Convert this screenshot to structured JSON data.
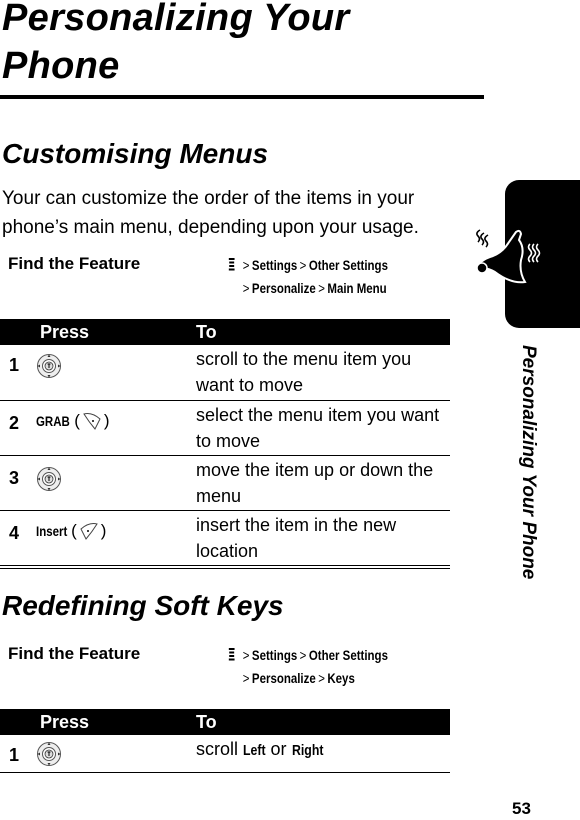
{
  "page": {
    "title": "Personalizing Your Phone",
    "side_tab_label": "Personalizing Your Phone",
    "page_number": "53",
    "side_icon": "bell-vibrate-icon"
  },
  "sections": [
    {
      "title": "Customising Menus",
      "intro": "Your can customize the order of the items in your phone’s main menu, depending upon your usage.",
      "find_feature": {
        "label": "Find the Feature",
        "icon": "menu-key-icon",
        "path_line1": [
          "Settings",
          "Other Settings"
        ],
        "path_line2": [
          "Personalize",
          "Main Menu"
        ],
        "separator": ">"
      },
      "table": {
        "headers": {
          "press": "Press",
          "to": "To"
        },
        "rows": [
          {
            "num": "1",
            "press_label": "",
            "press_icon": "nav-key-icon",
            "to": "scroll to the menu item you want to move"
          },
          {
            "num": "2",
            "press_label": "GRAB",
            "press_icon": "left-soft-key-icon",
            "to": "select the menu item you want to move"
          },
          {
            "num": "3",
            "press_label": "",
            "press_icon": "nav-key-icon",
            "to": "move the item up or down the menu"
          },
          {
            "num": "4",
            "press_label": "Insert",
            "press_icon": "right-soft-key-icon",
            "to": "insert the item in the new location"
          }
        ]
      }
    },
    {
      "title": "Redefining Soft Keys",
      "find_feature": {
        "label": "Find the Feature",
        "icon": "menu-key-icon",
        "path_line1": [
          "Settings",
          "Other Settings"
        ],
        "path_line2": [
          "Personalize",
          "Keys"
        ],
        "separator": ">"
      },
      "table": {
        "headers": {
          "press": "Press",
          "to": "To"
        },
        "rows": [
          {
            "num": "1",
            "press_label": "",
            "press_icon": "nav-key-icon",
            "to_prefix": "scroll",
            "to_opt1": "Left",
            "to_mid": "or",
            "to_opt2": "Right"
          }
        ]
      }
    }
  ],
  "symbols": {
    "paren_open": "(",
    "paren_close": ")"
  }
}
